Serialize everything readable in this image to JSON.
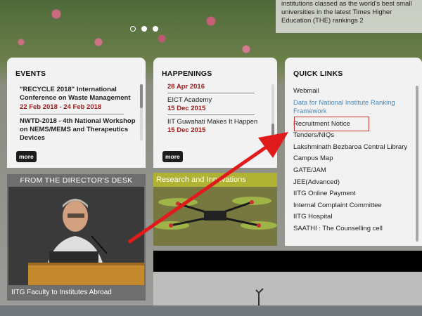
{
  "hero": {
    "caption": "institutions classed as the world's best small universities in the latest Times Higher Education (THE) rankings 2"
  },
  "events": {
    "title": "EVENTS",
    "items": [
      {
        "title": "\"RECYCLE 2018\" International Conference on Waste Management",
        "date": "22 Feb 2018 - 24 Feb 2018"
      },
      {
        "title": "NWTD-2018 - 4th National Workshop on NEMS/MEMS and Therapeutics Devices",
        "date": ""
      }
    ],
    "more_label": "more"
  },
  "happenings": {
    "title": "HAPPENINGS",
    "items": [
      {
        "title": "",
        "date": "28 Apr 2016"
      },
      {
        "title": "EICT Academy",
        "date": "15 Dec 2015"
      },
      {
        "title": "IIT Guwahati Makes It Happen",
        "date": "15 Dec 2015"
      }
    ],
    "more_label": "more"
  },
  "quick_links": {
    "title": "QUICK LINKS",
    "items": [
      "Webmail",
      "Data for National Institute Ranking Framework",
      "Recruitment Notice",
      "Tenders/NIQs",
      "Lakshminath Bezbaroa Central Library",
      "Campus Map",
      "GATE/JAM",
      "JEE(Advanced)",
      "IITG Online Payment",
      "Internal Complaint Committee",
      "IITG Hospital",
      "SAATHI : The Counselling cell"
    ]
  },
  "director": {
    "title": "FROM THE DIRECTOR'S DESK",
    "caption": "IITG Faculty to Institutes Abroad"
  },
  "research": {
    "title": "Research and Innovations"
  },
  "colors": {
    "date_red": "#9b1b1b",
    "highlight_red": "#c0312b",
    "arrow_red": "#e11b1b",
    "link_blue": "#4a86b7"
  }
}
